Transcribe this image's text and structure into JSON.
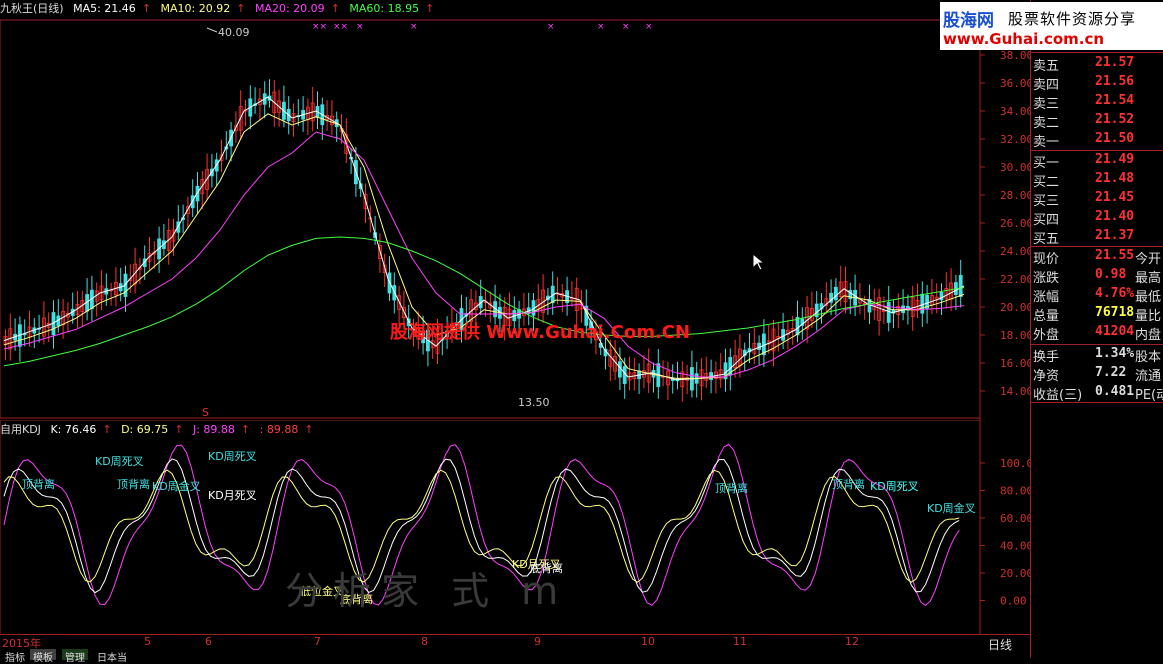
{
  "topbar": {
    "indicator": "九秋王(日线)",
    "ma5": "MA5: 21.46",
    "ma10": "MA10: 20.92",
    "ma20": "MA20: 20.09",
    "ma60": "MA60: 18.95",
    "colors": {
      "ma5": "#ffffff",
      "ma10": "#ffff80",
      "ma20": "#ff40ff",
      "ma60": "#40ff40"
    }
  },
  "kdjbar": {
    "name": "自用KDJ",
    "k": "K: 76.46",
    "d": "D: 69.75",
    "j": "J: 89.88",
    "extra": ": 89.88"
  },
  "price_axis": [
    "38.00",
    "36.00",
    "34.00",
    "32.00",
    "30.00",
    "28.00",
    "26.00",
    "24.00",
    "22.00",
    "20.00",
    "18.00",
    "16.00",
    "14.00"
  ],
  "kdj_axis": [
    "100.0",
    "80.00",
    "60.00",
    "40.00",
    "20.00",
    "0.00"
  ],
  "annotations": {
    "high": "40.09",
    "low": "13.50"
  },
  "kdj_notes": [
    "KD周死叉",
    "顶背离",
    "KD周死叉",
    "顶背离",
    "KD周金叉",
    "KD月死叉",
    "低位金叉",
    "底背离",
    "KD月死叉",
    "KD周死叉",
    "顶背离",
    "顶背离",
    "KD周死叉",
    "KD周金叉",
    "底背离"
  ],
  "months": [
    "2015年",
    "5",
    "6",
    "7",
    "8",
    "9",
    "10",
    "11",
    "12"
  ],
  "period": "日线",
  "tabs": [
    "指标",
    "模板",
    "管理",
    "日本当"
  ],
  "logo": {
    "line1": "股海网",
    "line1b": "股票软件资源分享",
    "line2": "www.Guhai.com.cn"
  },
  "watermark": "股海网提供 Www.Guhai.Com.CN",
  "watermark2": "分析家    式      m",
  "orderbook": {
    "sell": [
      {
        "label": "卖五",
        "price": "21.57"
      },
      {
        "label": "卖四",
        "price": "21.56"
      },
      {
        "label": "卖三",
        "price": "21.54"
      },
      {
        "label": "卖二",
        "price": "21.52"
      },
      {
        "label": "卖一",
        "price": "21.50"
      }
    ],
    "buy": [
      {
        "label": "买一",
        "price": "21.49"
      },
      {
        "label": "买二",
        "price": "21.48"
      },
      {
        "label": "买三",
        "price": "21.45"
      },
      {
        "label": "买四",
        "price": "21.40"
      },
      {
        "label": "买五",
        "price": "21.37"
      }
    ]
  },
  "quote": [
    {
      "label": "现价",
      "value": "21.55",
      "extra": "今开",
      "color": "#ff3030"
    },
    {
      "label": "涨跌",
      "value": "0.98",
      "extra": "最高",
      "color": "#ff3030"
    },
    {
      "label": "涨幅",
      "value": "4.76%",
      "extra": "最低",
      "color": "#ff3030"
    },
    {
      "label": "总量",
      "value": "76718",
      "extra": "量比",
      "color": "#ffff40"
    },
    {
      "label": "外盘",
      "value": "41204",
      "extra": "内盘",
      "color": "#ff3030"
    }
  ],
  "finance": [
    {
      "label": "换手",
      "value": "1.34%",
      "extra": "股本"
    },
    {
      "label": "净资",
      "value": "7.22",
      "extra": "流通"
    },
    {
      "label": "收益(三)",
      "value": "0.481",
      "extra": "PE(动"
    }
  ],
  "chart_data": {
    "type": "line",
    "series": [
      {
        "name": "MA5",
        "values": [
          17.6,
          18.2,
          18.8,
          19.8,
          21.0,
          21.5,
          23.5,
          25.0,
          28.0,
          30.5,
          34.0,
          35.0,
          33.5,
          34.0,
          33.0,
          28.0,
          22.0,
          18.5,
          17.2,
          19.0,
          20.5,
          19.2,
          19.8,
          21.0,
          20.5,
          17.0,
          15.0,
          15.3,
          14.8,
          14.9,
          15.2,
          16.8,
          17.5,
          18.4,
          19.8,
          21.3,
          20.2,
          19.6,
          20.0,
          20.6,
          21.5
        ]
      },
      {
        "name": "MA10",
        "values": [
          17.3,
          17.8,
          18.4,
          19.2,
          20.3,
          21.0,
          22.5,
          24.0,
          26.5,
          29.0,
          32.5,
          33.8,
          33.0,
          33.6,
          33.0,
          30.0,
          24.5,
          20.0,
          18.0,
          18.5,
          19.8,
          19.5,
          19.6,
          20.5,
          20.4,
          18.0,
          15.6,
          15.2,
          14.9,
          14.9,
          15.0,
          16.2,
          17.0,
          18.0,
          19.2,
          20.8,
          20.5,
          19.8,
          19.8,
          20.3,
          20.9
        ]
      },
      {
        "name": "MA20",
        "values": [
          17.0,
          17.4,
          17.9,
          18.4,
          19.2,
          20.0,
          21.0,
          22.0,
          23.5,
          25.5,
          28.0,
          30.0,
          31.0,
          32.5,
          32.0,
          30.5,
          27.0,
          23.5,
          21.0,
          19.5,
          19.5,
          19.5,
          19.6,
          20.0,
          20.2,
          19.2,
          17.2,
          16.0,
          15.3,
          15.0,
          15.0,
          15.5,
          16.2,
          17.2,
          18.4,
          19.8,
          20.2,
          20.0,
          19.8,
          19.9,
          20.1
        ]
      },
      {
        "name": "MA60",
        "values": [
          15.8,
          16.1,
          16.5,
          16.9,
          17.4,
          18.0,
          18.6,
          19.3,
          20.2,
          21.3,
          22.6,
          23.7,
          24.4,
          24.9,
          25.0,
          24.9,
          24.6,
          24.0,
          23.3,
          22.4,
          21.3,
          20.2,
          19.3,
          18.6,
          18.2,
          18.0,
          17.9,
          17.9,
          18.0,
          18.1,
          18.3,
          18.5,
          18.8,
          19.1,
          19.5,
          19.9,
          20.2,
          20.5,
          20.8,
          21.1,
          21.4
        ]
      }
    ],
    "ylim": [
      13,
      39
    ]
  }
}
